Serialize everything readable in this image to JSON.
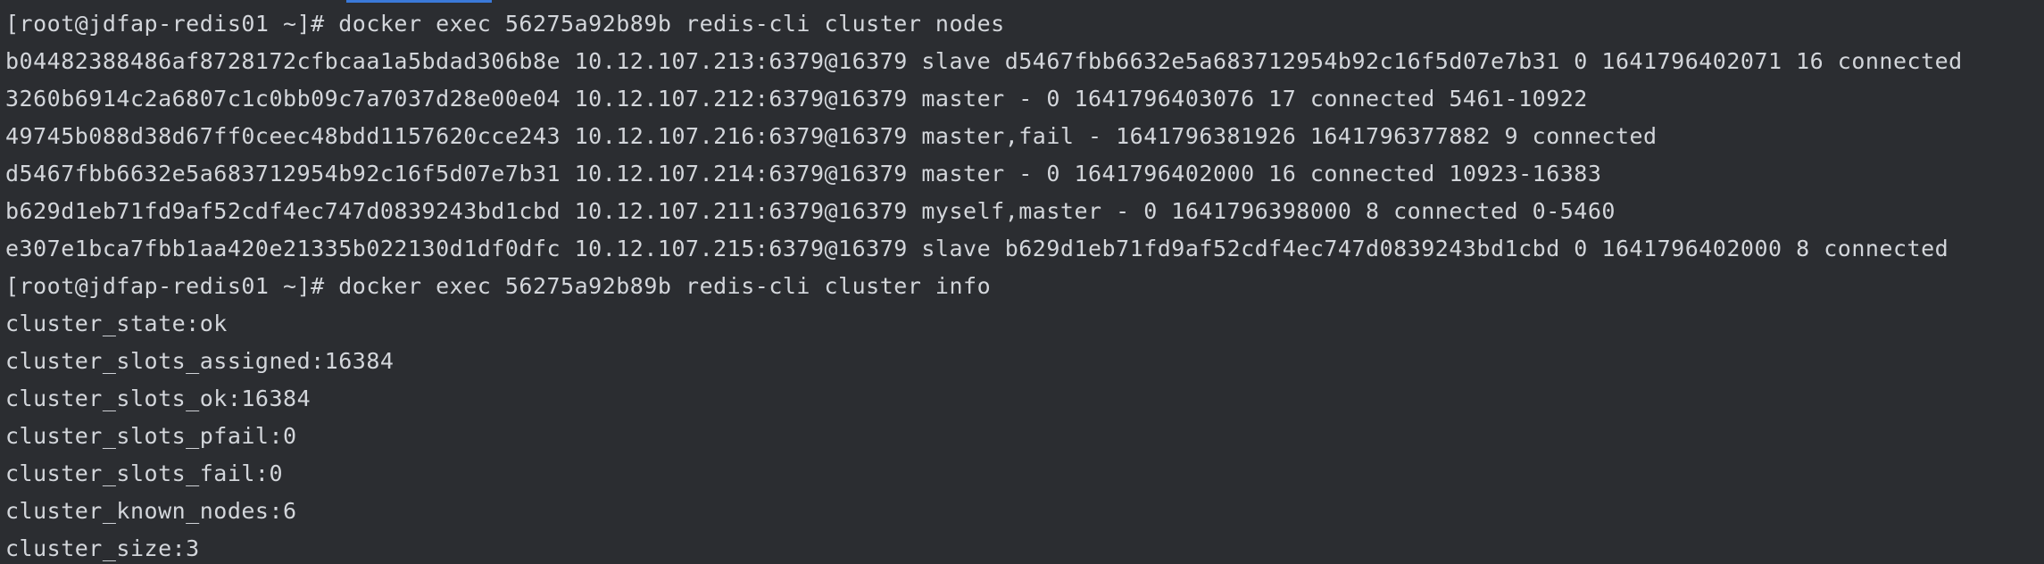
{
  "accent_color": "#3a79d9",
  "background_color": "#2b2d31",
  "text_color": "#d3d6db",
  "lines": [
    "[root@jdfap-redis01 ~]# docker exec 56275a92b89b redis-cli cluster nodes",
    "b04482388486af8728172cfbcaa1a5bdad306b8e 10.12.107.213:6379@16379 slave d5467fbb6632e5a683712954b92c16f5d07e7b31 0 1641796402071 16 connected",
    "3260b6914c2a6807c1c0bb09c7a7037d28e00e04 10.12.107.212:6379@16379 master - 0 1641796403076 17 connected 5461-10922",
    "49745b088d38d67ff0ceec48bdd1157620cce243 10.12.107.216:6379@16379 master,fail - 1641796381926 1641796377882 9 connected",
    "d5467fbb6632e5a683712954b92c16f5d07e7b31 10.12.107.214:6379@16379 master - 0 1641796402000 16 connected 10923-16383",
    "b629d1eb71fd9af52cdf4ec747d0839243bd1cbd 10.12.107.211:6379@16379 myself,master - 0 1641796398000 8 connected 0-5460",
    "e307e1bca7fbb1aa420e21335b022130d1df0dfc 10.12.107.215:6379@16379 slave b629d1eb71fd9af52cdf4ec747d0839243bd1cbd 0 1641796402000 8 connected",
    "[root@jdfap-redis01 ~]# docker exec 56275a92b89b redis-cli cluster info",
    "cluster_state:ok",
    "cluster_slots_assigned:16384",
    "cluster_slots_ok:16384",
    "cluster_slots_pfail:0",
    "cluster_slots_fail:0",
    "cluster_known_nodes:6",
    "cluster_size:3"
  ]
}
